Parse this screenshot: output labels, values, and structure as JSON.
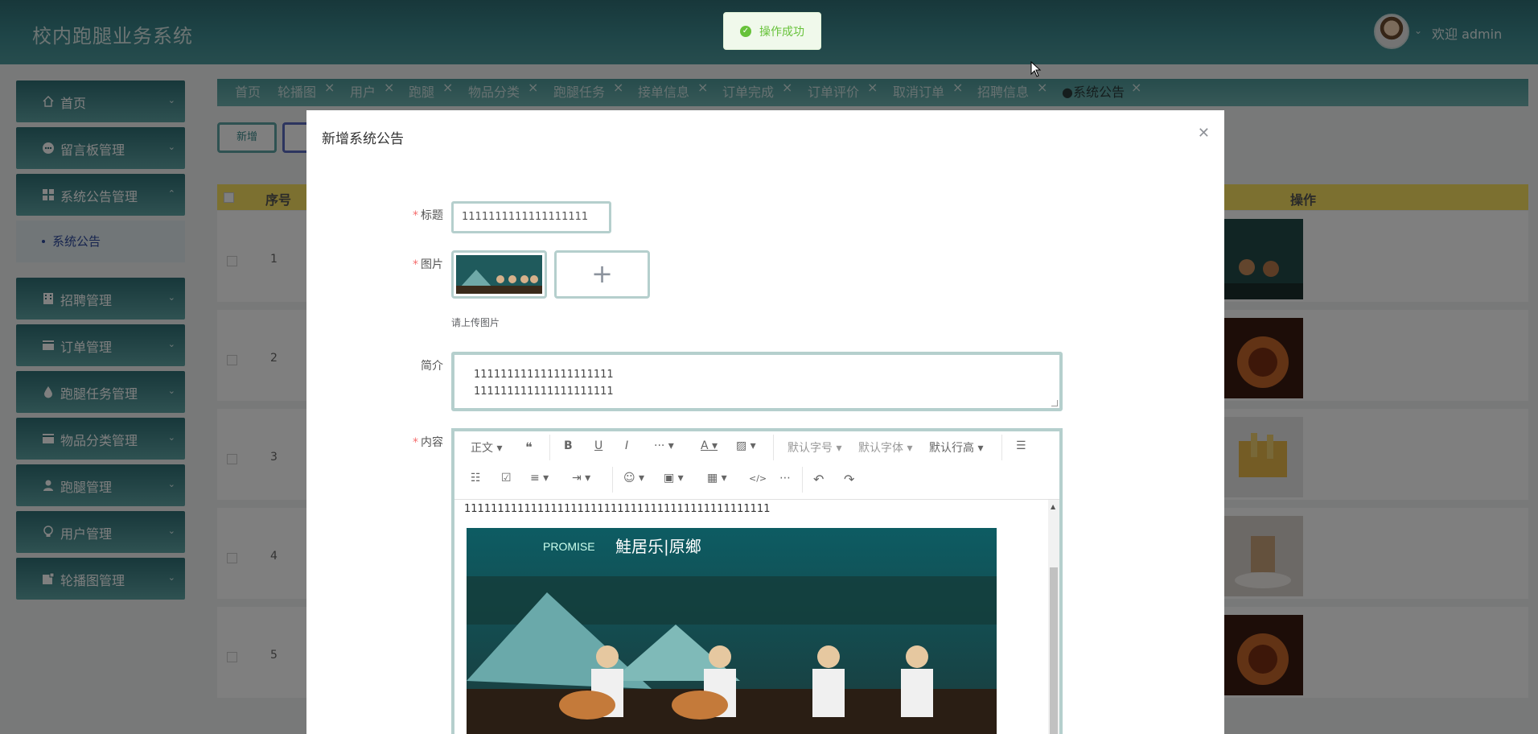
{
  "app": {
    "title": "校内跑腿业务系统"
  },
  "toast": {
    "text": "操作成功",
    "color": "#67c23a"
  },
  "user": {
    "welcome": "欢迎 admin"
  },
  "sidebar": {
    "items": [
      {
        "label": "首页",
        "icon": "home-icon"
      },
      {
        "label": "留言板管理",
        "icon": "chat-icon"
      },
      {
        "label": "系统公告管理",
        "icon": "grid-icon"
      },
      {
        "label": "招聘管理",
        "icon": "building-icon"
      },
      {
        "label": "订单管理",
        "icon": "card-icon"
      },
      {
        "label": "跑腿任务管理",
        "icon": "drop-icon"
      },
      {
        "label": "物品分类管理",
        "icon": "card-icon"
      },
      {
        "label": "跑腿管理",
        "icon": "person-icon"
      },
      {
        "label": "用户管理",
        "icon": "lightbulb-icon"
      },
      {
        "label": "轮播图管理",
        "icon": "image-icon"
      }
    ],
    "submenu": {
      "label": "系统公告"
    }
  },
  "tabs": [
    {
      "label": "首页"
    },
    {
      "label": "轮播图"
    },
    {
      "label": "用户"
    },
    {
      "label": "跑腿"
    },
    {
      "label": "物品分类"
    },
    {
      "label": "跑腿任务"
    },
    {
      "label": "接单信息"
    },
    {
      "label": "订单完成"
    },
    {
      "label": "订单评价"
    },
    {
      "label": "取消订单"
    },
    {
      "label": "招聘信息"
    },
    {
      "label": "系统公告",
      "active": true
    }
  ],
  "toolbar": {
    "add_label": "新增"
  },
  "table": {
    "headers": {
      "index": "序号",
      "actions": "操作"
    },
    "rows": [
      {
        "index": "1"
      },
      {
        "index": "2"
      },
      {
        "index": "3"
      },
      {
        "index": "4"
      },
      {
        "index": "5"
      }
    ]
  },
  "dialog": {
    "title": "新增系统公告",
    "fields": {
      "title": {
        "label": "标题",
        "value": "1111111111111111111"
      },
      "image": {
        "label": "图片",
        "hint": "请上传图片"
      },
      "intro": {
        "label": "简介",
        "lines": [
          "111111111111111111111",
          "111111111111111111111"
        ]
      },
      "content": {
        "label": "内容",
        "text": "1111111111111111111111111111111111111111111111"
      }
    },
    "editor_toolbar": {
      "row1": [
        "正文",
        "❝",
        "B",
        "U",
        "I",
        "···",
        "A",
        "▨",
        "默认字号",
        "默认字体",
        "默认行高",
        "☰"
      ],
      "row2": [
        "☷",
        "☑",
        "≡",
        "⇥",
        "☺",
        "▣",
        "▦",
        "</>",
        "⋯",
        "↶",
        "↷"
      ]
    },
    "image_caption": {
      "brand": "PROMISE",
      "title": "鮭居乐|原鄉"
    }
  }
}
